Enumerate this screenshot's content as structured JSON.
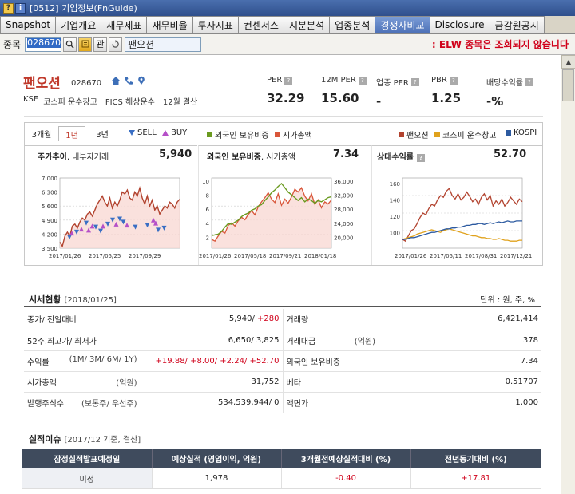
{
  "window": {
    "title": "[0512] 기업정보(FnGuide)",
    "icons": [
      "?",
      "i"
    ]
  },
  "tabs": [
    "Snapshot",
    "기업개요",
    "재무제표",
    "재무비율",
    "투자지표",
    "컨센서스",
    "지분분석",
    "업종분석",
    "경쟁사비교",
    "Disclosure",
    "금감원공시"
  ],
  "active_tab": 8,
  "search": {
    "label": "종목",
    "code_value": "028670",
    "btn_search": "search-icon",
    "btn_fav": "관",
    "company_name": "팬오션",
    "notice": "ELW 종목은 조회되지 않습니다"
  },
  "company": {
    "name": "팬오션",
    "code": "028670",
    "market": "KSE",
    "sector_kospi": "코스피 운수창고",
    "sector_fics": "FICS 해상운수",
    "fiscal": "12월 결산"
  },
  "kpis": [
    {
      "label": "PER",
      "value": "32.29"
    },
    {
      "label": "12M PER",
      "value": "15.60"
    },
    {
      "label": "업종 PER",
      "value": "-"
    },
    {
      "label": "PBR",
      "value": "1.25"
    },
    {
      "label": "배당수익률",
      "value": "-%"
    }
  ],
  "periods": [
    "3개월",
    "1년",
    "3년"
  ],
  "active_period": 1,
  "legend": {
    "sell": "SELL",
    "buy": "BUY",
    "foreign": "외국인 보유비중",
    "mcap": "시가총액",
    "company": "팬오션",
    "kospi_sector": "코스피 운수창고",
    "kospi": "KOSPI"
  },
  "colors": {
    "company": "#b2432f",
    "sector": "#e0a21d",
    "kospi": "#2c5aa0",
    "foreign": "#6a9a1f",
    "mcap": "#d9563a",
    "sell": "#3a6fc4",
    "buy": "#b54fc8"
  },
  "panels": [
    {
      "title": "주가추이",
      "subtitle": ", 내부자거래",
      "value": "5,940"
    },
    {
      "title": "외국인 보유비중",
      "subtitle": ", 시가총액",
      "value": "7.34"
    },
    {
      "title": "상대수익률",
      "subtitle": "",
      "value": "52.70"
    }
  ],
  "chart_data": [
    {
      "type": "area",
      "title": "주가추이, 내부자거래",
      "x": [
        "2017/01/26",
        "2017/05/25",
        "2017/09/29"
      ],
      "yticks": [
        "7,000",
        "6,300",
        "5,600",
        "4,900",
        "4,200",
        "3,500"
      ],
      "ylim": [
        3500,
        7000
      ],
      "series": [
        {
          "name": "팬오션",
          "values": [
            3800,
            3600,
            4100,
            4300,
            4100,
            4600,
            4700,
            4500,
            4800,
            5000,
            4900,
            5200,
            5300,
            5100,
            5400,
            5700,
            5900,
            6100,
            5800,
            5600,
            6000,
            5500,
            5800,
            5600,
            5900,
            6300,
            6200,
            6400,
            6000,
            5900,
            6300,
            6100,
            6500,
            6000,
            5700,
            6100,
            5600,
            5900,
            5400,
            5600,
            5200,
            5400,
            5600,
            5500,
            5800,
            5700,
            5500,
            5800,
            5940
          ]
        }
      ],
      "sell": [
        [
          0.08,
          4050
        ],
        [
          0.14,
          4300
        ],
        [
          0.22,
          4750
        ],
        [
          0.3,
          4550
        ],
        [
          0.34,
          4350
        ],
        [
          0.4,
          4700
        ],
        [
          0.44,
          4900
        ],
        [
          0.5,
          4950
        ],
        [
          0.53,
          4800
        ],
        [
          0.63,
          4550
        ],
        [
          0.73,
          4650
        ],
        [
          0.82,
          4400
        ],
        [
          0.87,
          4500
        ]
      ],
      "buy": [
        [
          0.1,
          4250
        ],
        [
          0.18,
          4450
        ],
        [
          0.24,
          4400
        ],
        [
          0.27,
          4600
        ],
        [
          0.36,
          4600
        ],
        [
          0.47,
          4700
        ],
        [
          0.56,
          4650
        ],
        [
          0.78,
          4900
        ],
        [
          0.8,
          4750
        ]
      ]
    },
    {
      "type": "line",
      "title": "외국인 보유비중, 시가총액",
      "x": [
        "2017/01/26",
        "2017/05/18",
        "2017/09/21",
        "2018/01/18"
      ],
      "yticks_left": [
        "10",
        "8",
        "6",
        "4",
        "2"
      ],
      "ylim_left": [
        0,
        10
      ],
      "yticks_right": [
        "36,000",
        "32,000",
        "28,000",
        "24,000",
        "20,000"
      ],
      "ylim_right": [
        18000,
        38000
      ],
      "series": [
        {
          "name": "외국인 보유비중",
          "values": [
            1.8,
            1.9,
            2.0,
            2.4,
            3.0,
            3.5,
            3.4,
            3.7,
            4.0,
            4.5,
            4.8,
            5.0,
            5.4,
            5.6,
            6.0,
            6.2,
            6.8,
            7.3,
            7.9,
            8.3,
            8.8,
            9.2,
            8.6,
            8.0,
            7.6,
            7.2,
            6.8,
            7.2,
            6.6,
            7.0,
            6.8,
            6.4,
            6.8,
            6.6,
            6.9,
            7.2,
            7.34
          ]
        },
        {
          "name": "시가총액",
          "values": [
            20500,
            20000,
            21500,
            22800,
            22300,
            24500,
            25200,
            24300,
            25800,
            26800,
            26100,
            27600,
            28700,
            27500,
            29800,
            31200,
            32400,
            33800,
            32000,
            31000,
            33500,
            30200,
            32000,
            30800,
            32600,
            34800,
            34000,
            35200,
            32800,
            31500,
            33500,
            30500,
            31800,
            29500,
            31200,
            30600,
            31752
          ]
        }
      ]
    },
    {
      "type": "line",
      "title": "상대수익률",
      "x": [
        "2017/01/26",
        "2017/05/11",
        "2017/08/31",
        "2017/12/21"
      ],
      "yticks": [
        "160",
        "140",
        "120",
        "100"
      ],
      "ylim": [
        90,
        170
      ],
      "series": [
        {
          "name": "팬오션",
          "values": [
            100,
            98,
            104,
            110,
            112,
            118,
            125,
            130,
            128,
            135,
            140,
            138,
            145,
            150,
            148,
            155,
            158,
            150,
            146,
            152,
            145,
            148,
            154,
            149,
            143,
            146,
            140,
            148,
            152,
            145,
            150,
            138,
            144,
            140,
            146,
            138,
            142,
            148,
            144,
            140,
            146,
            143
          ]
        },
        {
          "name": "코스피 운수창고",
          "values": [
            100,
            101,
            102,
            103,
            104,
            106,
            107,
            108,
            109,
            110,
            111,
            110,
            109,
            108,
            110,
            111,
            112,
            111,
            110,
            109,
            108,
            107,
            106,
            105,
            104,
            104,
            103,
            102,
            102,
            101,
            101,
            100,
            100,
            101,
            100,
            99,
            99,
            98,
            98,
            98,
            99,
            99
          ]
        },
        {
          "name": "KOSPI",
          "values": [
            100,
            100,
            101,
            102,
            102,
            103,
            104,
            105,
            106,
            107,
            108,
            108,
            109,
            110,
            111,
            112,
            112,
            113,
            113,
            114,
            114,
            115,
            116,
            116,
            117,
            117,
            118,
            118,
            117,
            118,
            119,
            118,
            119,
            120,
            119,
            120,
            121,
            120,
            120,
            121,
            121,
            121
          ]
        }
      ]
    }
  ],
  "market": {
    "title": "시세현황",
    "date": "[2018/01/25]",
    "unit": "단위 : 원, 주, %",
    "rows": [
      {
        "l": "종가/ 전일대비",
        "ls": "",
        "v": "5,940/",
        "vr": "+280",
        "l2": "거래량",
        "l2s": "",
        "v2": "6,421,414"
      },
      {
        "l": "52주.최고가/ 최저가",
        "ls": "",
        "v": "6,650/ 3,825",
        "vr": "",
        "l2": "거래대금",
        "l2s": "(억원)",
        "v2": "378"
      },
      {
        "l": "수익률",
        "ls": "(1M/ 3M/ 6M/ 1Y)",
        "v": "",
        "vr": "+19.88/ +8.00/ +2.24/ +52.70",
        "l2": "외국인 보유비중",
        "l2s": "",
        "v2": "7.34"
      },
      {
        "l": "시가총액",
        "ls": "(억원)",
        "v": "31,752",
        "vr": "",
        "l2": "베타",
        "l2s": "",
        "v2": "0.51707"
      },
      {
        "l": "발행주식수",
        "ls": "(보통주/ 우선주)",
        "v": "534,539,944/ 0",
        "vr": "",
        "l2": "액면가",
        "l2s": "",
        "v2": "1,000"
      }
    ]
  },
  "perf": {
    "title": "실적이슈",
    "date": "[2017/12 기준, 결산]",
    "headers": [
      "잠정실적발표예정일",
      "예상실적 (영업이익, 억원)",
      "3개월전예상실적대비 (%)",
      "전년동기대비 (%)"
    ],
    "row": [
      "미정",
      "1,978",
      "-0.40",
      "+17.81"
    ]
  }
}
